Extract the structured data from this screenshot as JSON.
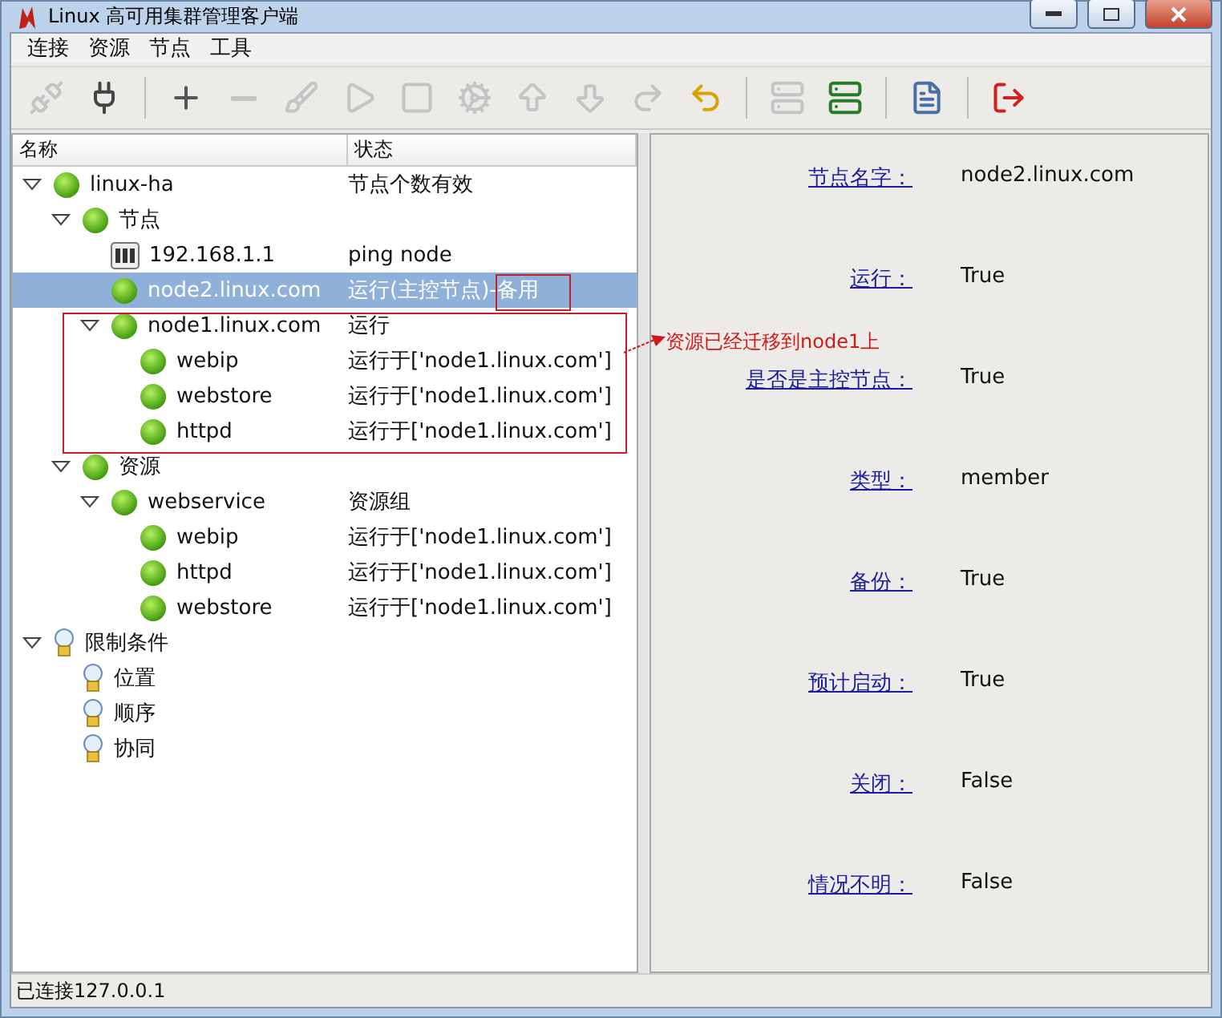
{
  "window": {
    "title": "Linux 高可用集群管理客户端"
  },
  "menu": [
    "连接",
    "资源",
    "节点",
    "工具"
  ],
  "toolbar": [
    {
      "kind": "disconnect",
      "disabled": true
    },
    {
      "kind": "connect",
      "disabled": false
    },
    {
      "kind": "separator"
    },
    {
      "kind": "add",
      "disabled": false
    },
    {
      "kind": "remove",
      "disabled": true
    },
    {
      "kind": "clean",
      "disabled": true
    },
    {
      "kind": "start",
      "disabled": true
    },
    {
      "kind": "stop",
      "disabled": true
    },
    {
      "kind": "settings",
      "disabled": true
    },
    {
      "kind": "up",
      "disabled": true
    },
    {
      "kind": "down",
      "disabled": true
    },
    {
      "kind": "redo",
      "disabled": true
    },
    {
      "kind": "undo",
      "disabled": false
    },
    {
      "kind": "separator"
    },
    {
      "kind": "standby",
      "disabled": true
    },
    {
      "kind": "online",
      "disabled": false
    },
    {
      "kind": "separator"
    },
    {
      "kind": "document",
      "disabled": false
    },
    {
      "kind": "separator"
    },
    {
      "kind": "exit",
      "disabled": false
    }
  ],
  "tree": {
    "columns": [
      "名称",
      "状态"
    ],
    "items": [
      {
        "name": "linux-ha",
        "status": "节点个数有效",
        "kind": "ok",
        "expanded": true,
        "selected": false,
        "children": [
          {
            "name": "节点",
            "kind": "ok",
            "expanded": true,
            "selected": false,
            "children": [
              {
                "name": "192.168.1.1",
                "status": "ping node",
                "kind": "host",
                "selected": false
              },
              {
                "name": "node2.linux.com",
                "status": "运行(主控节点)-备用",
                "kind": "ok",
                "selected": true
              },
              {
                "name": "node1.linux.com",
                "status": "运行",
                "kind": "ok",
                "expanded": true,
                "selected": false,
                "children": [
                  {
                    "name": "webip",
                    "status": "运行于['node1.linux.com']",
                    "kind": "ok",
                    "selected": false
                  },
                  {
                    "name": "webstore",
                    "status": "运行于['node1.linux.com']",
                    "kind": "ok",
                    "selected": false
                  },
                  {
                    "name": "httpd",
                    "status": "运行于['node1.linux.com']",
                    "kind": "ok",
                    "selected": false
                  }
                ]
              }
            ]
          },
          {
            "name": "资源",
            "kind": "ok",
            "expanded": true,
            "selected": false,
            "children": [
              {
                "name": "webservice",
                "status": "资源组",
                "kind": "ok",
                "expanded": true,
                "selected": false,
                "children": [
                  {
                    "name": "webip",
                    "status": "运行于['node1.linux.com']",
                    "kind": "ok",
                    "selected": false
                  },
                  {
                    "name": "httpd",
                    "status": "运行于['node1.linux.com']",
                    "kind": "ok",
                    "selected": false
                  },
                  {
                    "name": "webstore",
                    "status": "运行于['node1.linux.com']",
                    "kind": "ok",
                    "selected": false
                  }
                ]
              }
            ]
          }
        ]
      },
      {
        "name": "限制条件",
        "kind": "bulb",
        "expanded": true,
        "selected": false,
        "children": [
          {
            "name": "位置",
            "kind": "bulb",
            "selected": false
          },
          {
            "name": "顺序",
            "kind": "bulb",
            "selected": false
          },
          {
            "name": "协同",
            "kind": "bulb",
            "selected": false
          }
        ]
      }
    ]
  },
  "annotation": {
    "text": "资源已经迁移到node1上"
  },
  "details": [
    {
      "label": "节点名字：",
      "value": "node2.linux.com"
    },
    {
      "label": "运行：",
      "value": "True"
    },
    {
      "label": "是否是主控节点：",
      "value": "True"
    },
    {
      "label": "类型：",
      "value": "member"
    },
    {
      "label": "备份：",
      "value": "True"
    },
    {
      "label": "预计启动：",
      "value": "True"
    },
    {
      "label": "关闭：",
      "value": "False"
    },
    {
      "label": "情况不明：",
      "value": "False"
    }
  ],
  "status_bar": "已连接127.0.0.1"
}
